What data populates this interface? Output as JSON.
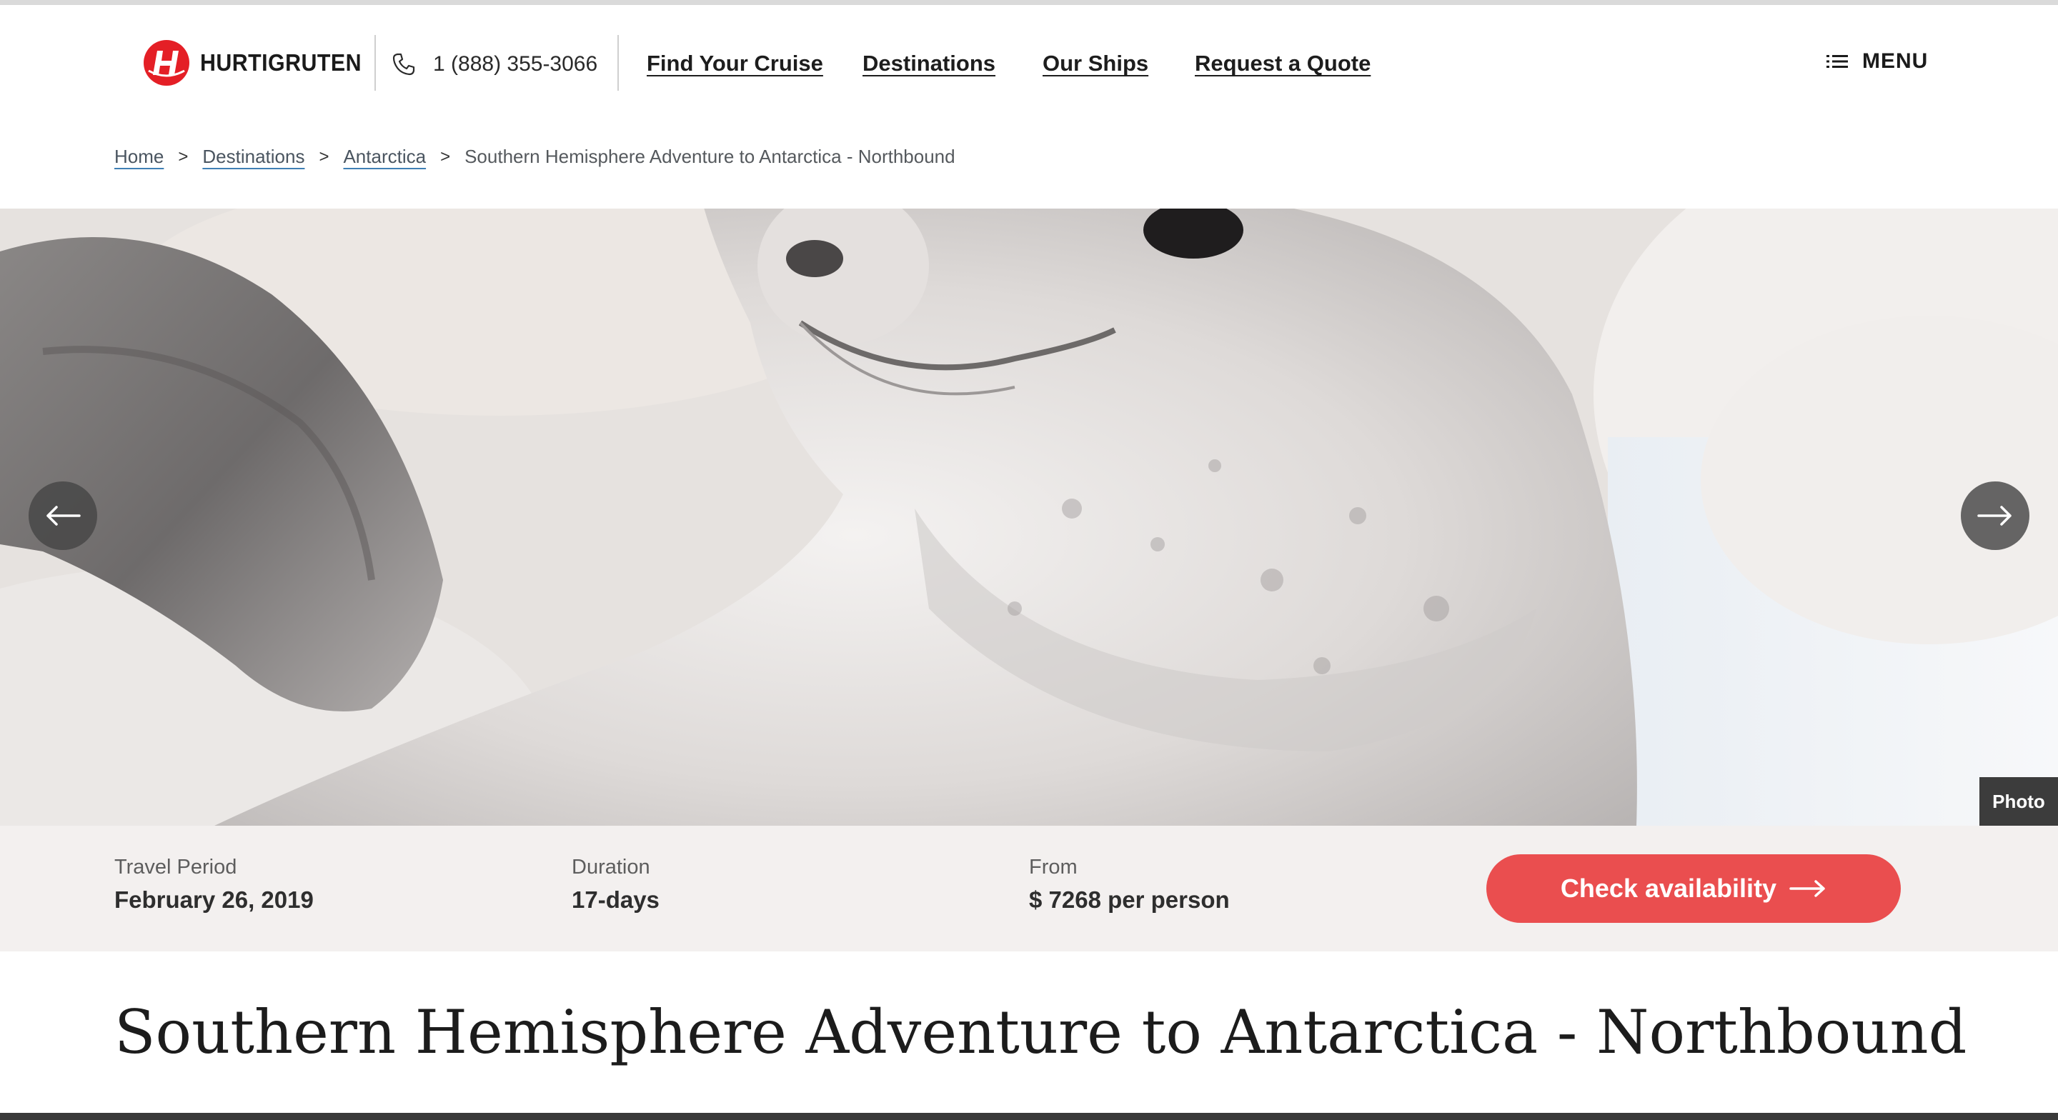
{
  "brand": {
    "name": "HURTIGRUTEN",
    "accent": "#e41f26"
  },
  "header": {
    "phone": "1 (888) 355-3066",
    "nav": [
      "Find Your Cruise",
      "Destinations",
      "Our Ships",
      "Request a Quote"
    ],
    "menu_label": "MENU",
    "icons": {
      "phone": "phone-icon",
      "menu": "list-menu-icon"
    }
  },
  "breadcrumb": {
    "items": [
      "Home",
      "Destinations",
      "Antarctica"
    ],
    "separator": ">",
    "current": "Southern Hemisphere Adventure to Antarctica - Northbound"
  },
  "hero": {
    "image": "crabeater seal resting on snow",
    "prev_icon": "arrow-left-icon",
    "next_icon": "arrow-right-icon",
    "photo_label": "Photo"
  },
  "info": {
    "travel_period_label": "Travel Period",
    "travel_period_value": "February 26, 2019",
    "duration_label": "Duration",
    "duration_value": "17-days",
    "from_label": "From",
    "from_value": "$ 7268 per person",
    "cta_label": "Check availability",
    "cta_color": "#ea4e4f"
  },
  "title": "Southern Hemisphere Adventure to Antarctica - Northbound"
}
